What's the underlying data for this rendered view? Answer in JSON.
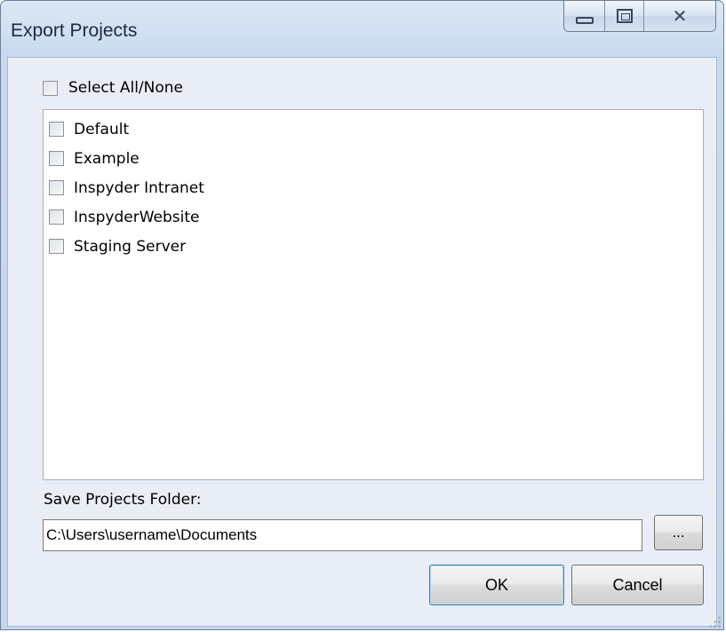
{
  "window": {
    "title": "Export Projects",
    "close_glyph": "✕"
  },
  "select_all": {
    "label": "Select All/None",
    "checked": false
  },
  "projects": [
    {
      "label": "Default",
      "checked": false
    },
    {
      "label": "Example",
      "checked": false
    },
    {
      "label": "Inspyder Intranet",
      "checked": false
    },
    {
      "label": "InspyderWebsite",
      "checked": false
    },
    {
      "label": "Staging Server",
      "checked": false
    }
  ],
  "folder": {
    "label": "Save Projects Folder:",
    "path": "C:\\Users\\username\\Documents",
    "browse_label": "..."
  },
  "buttons": {
    "ok": "OK",
    "cancel": "Cancel"
  },
  "icons": [
    "minimize-icon",
    "maximize-icon",
    "close-icon",
    "checkbox-icon",
    "resize-grip-icon"
  ]
}
